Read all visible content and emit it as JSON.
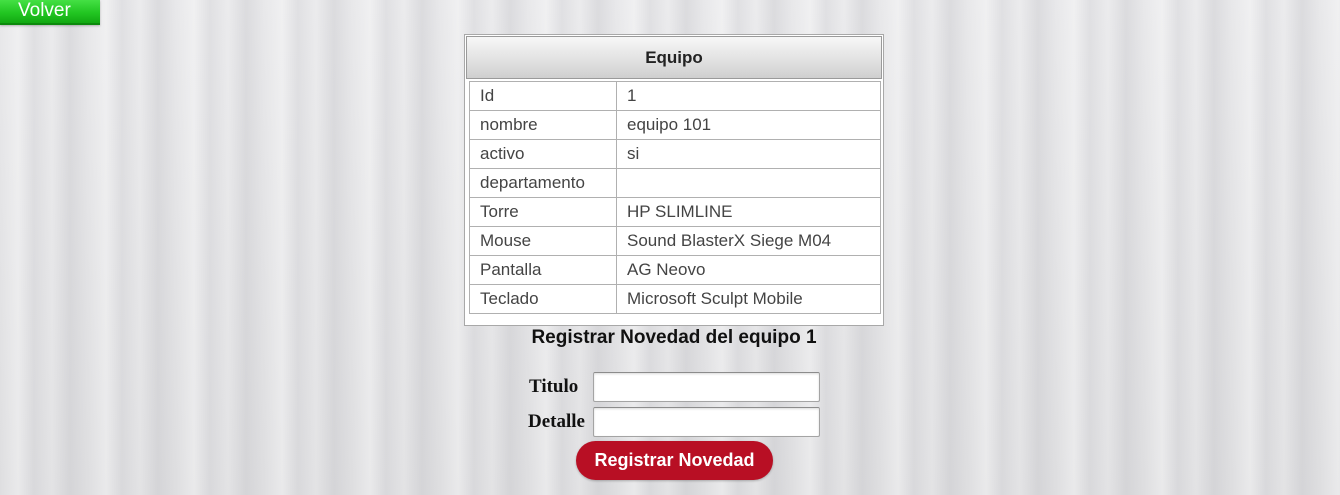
{
  "nav": {
    "back_label": "Volver"
  },
  "equipment": {
    "header": "Equipo",
    "rows": [
      {
        "key": "Id",
        "value": "1"
      },
      {
        "key": "nombre",
        "value": "equipo 101"
      },
      {
        "key": "activo",
        "value": "si"
      },
      {
        "key": "departamento",
        "value": ""
      },
      {
        "key": "Torre",
        "value": "HP SLIMLINE"
      },
      {
        "key": "Mouse",
        "value": "Sound BlasterX Siege M04"
      },
      {
        "key": "Pantalla",
        "value": "AG Neovo"
      },
      {
        "key": "Teclado",
        "value": "Microsoft Sculpt Mobile"
      }
    ]
  },
  "form": {
    "title": "Registrar Novedad del equipo 1",
    "titulo_label": "Titulo",
    "titulo_value": "",
    "detalle_label": "Detalle",
    "detalle_value": "",
    "submit_label": "Registrar Novedad"
  },
  "colors": {
    "back_button": "#22c622",
    "submit_button": "#b80f24"
  }
}
